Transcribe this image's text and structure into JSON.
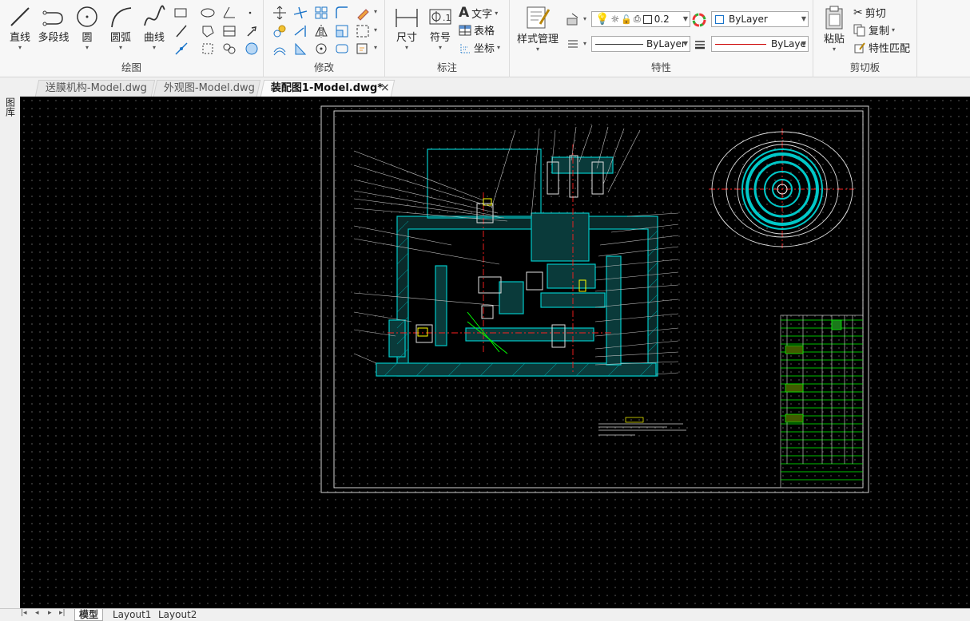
{
  "ribbon": {
    "draw": {
      "label": "绘图",
      "line": "直线",
      "polyline": "多段线",
      "circle": "圆",
      "arc": "圆弧",
      "spline": "曲线"
    },
    "modify": {
      "label": "修改"
    },
    "annotate": {
      "label": "标注",
      "dimension": "尺寸",
      "symbol": "符号",
      "text": "文字",
      "table": "表格",
      "coordinate": "坐标"
    },
    "properties": {
      "label": "特性",
      "style_manager": "样式管理",
      "lineweight": "0.2",
      "color": "ByLayer",
      "linetype": "ByLayer",
      "lineweight_combo": "ByLaye"
    },
    "clipboard": {
      "label": "剪切板",
      "paste": "粘贴",
      "cut": "剪切",
      "copy": "复制",
      "match": "特性匹配"
    }
  },
  "tabs": [
    {
      "label": "送膜机构-Model.dwg"
    },
    {
      "label": "外观图-Model.dwg"
    },
    {
      "label": "装配图1-Model.dwg*"
    }
  ],
  "tab_close": "×",
  "left_tool": {
    "label": "图库"
  },
  "bottom": {
    "model": "模型",
    "layout1": "Layout1",
    "layout2": "Layout2",
    "nav": [
      "|◂",
      "◂",
      "▸",
      "▸|"
    ]
  },
  "colors": {
    "canvas": "#000000",
    "hatch": "#00c8c8",
    "green": "#00ff00",
    "red": "#ff2020",
    "yellow": "#ffff00"
  }
}
